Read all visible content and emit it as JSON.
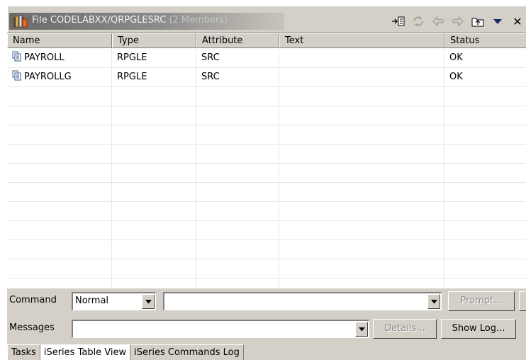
{
  "title": {
    "file": "File CODELABXX/QRPGLESRC",
    "members": "(2 Members)"
  },
  "toolbar": {
    "icons": [
      "show-in-table-icon",
      "refresh-icon",
      "back-icon",
      "forward-icon",
      "up-level-icon",
      "view-menu-icon",
      "close-icon"
    ]
  },
  "table": {
    "columns": [
      "Name",
      "Type",
      "Attribute",
      "Text",
      "Status"
    ],
    "rows": [
      {
        "name": "PAYROLL",
        "type": "RPGLE",
        "attribute": "SRC",
        "text": "",
        "status": "OK"
      },
      {
        "name": "PAYROLLG",
        "type": "RPGLE",
        "attribute": "SRC",
        "text": "",
        "status": "OK"
      }
    ]
  },
  "command": {
    "label": "Command",
    "mode": "Normal",
    "input_value": "",
    "prompt_label": "Prompt..."
  },
  "messages": {
    "label": "Messages",
    "value": "",
    "details_label": "Details...",
    "show_log_label": "Show Log..."
  },
  "tabs": [
    "Tasks",
    "iSeries Table View",
    "iSeries Commands Log"
  ],
  "colors": {
    "face": "#d4d0c8",
    "shadow": "#808080",
    "gridline": "#e6e6e6"
  }
}
